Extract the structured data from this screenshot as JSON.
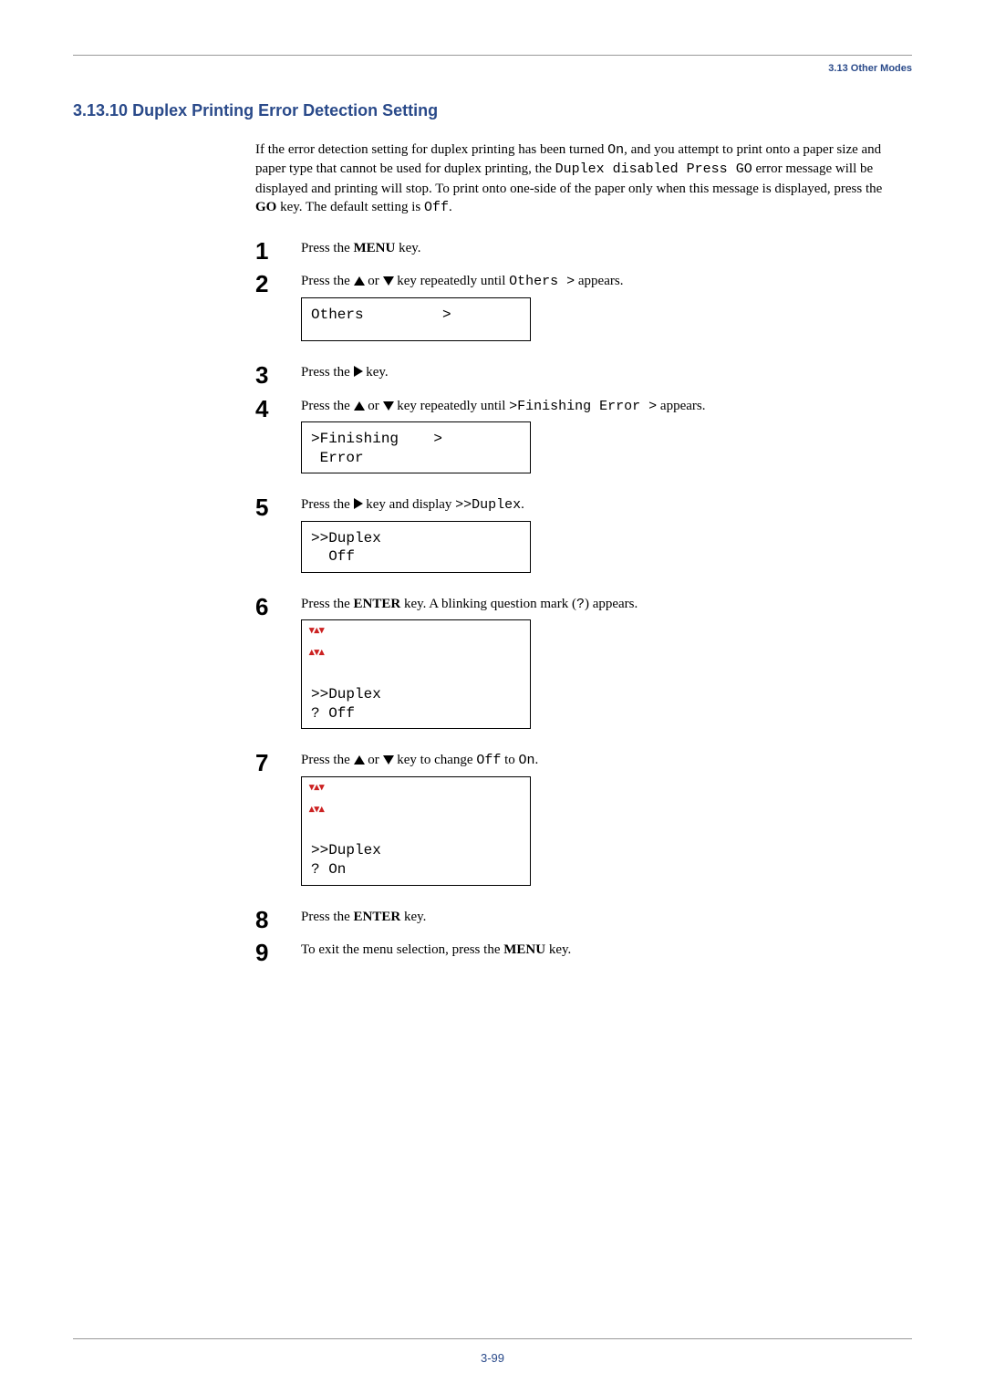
{
  "header": {
    "breadcrumb": "3.13 Other Modes"
  },
  "section": {
    "number": "3.13.10",
    "title": "Duplex Printing Error Detection Setting"
  },
  "intro": {
    "part1": "If the error detection setting for duplex printing has been turned ",
    "code1": "On",
    "part2": ", and you attempt to print onto a paper size and paper type that cannot be used for duplex printing, the ",
    "code2": "Duplex disabled Press GO",
    "part3": " error message will be displayed and printing will stop. To print onto one-side of the paper only when this message is displayed, press the ",
    "bold1": "GO",
    "part4": " key. The default setting is ",
    "code3": "Off",
    "part5": "."
  },
  "steps": {
    "s1": {
      "num": "1",
      "a": "Press the ",
      "b": "MENU",
      "c": " key."
    },
    "s2": {
      "num": "2",
      "a": "Press the ",
      "b_pre": " or ",
      "c": " key repeatedly until ",
      "code": "Others  >",
      "d": " appears.",
      "display_l1": "Others         >"
    },
    "s3": {
      "num": "3",
      "a": "Press the ",
      "c": " key."
    },
    "s4": {
      "num": "4",
      "a": "Press the ",
      "b_pre": " or ",
      "c": " key repeatedly until ",
      "code": ">Finishing Error  >",
      "d": " appears.",
      "display_l1": ">Finishing    >",
      "display_l2": " Error"
    },
    "s5": {
      "num": "5",
      "a": "Press the ",
      "c": " key and display ",
      "code": ">>Duplex",
      "d": ".",
      "display_l1": ">>Duplex",
      "display_l2": "  Off"
    },
    "s6": {
      "num": "6",
      "a": "Press the ",
      "b": "ENTER",
      "c": " key. A blinking question mark (",
      "code": "?",
      "d": ") appears.",
      "display_l1": ">>Duplex",
      "display_l2": "? Off"
    },
    "s7": {
      "num": "7",
      "a": "Press the ",
      "b_pre": " or ",
      "c": " key to change ",
      "code1": "Off",
      "mid": " to ",
      "code2": "On",
      "d": ".",
      "display_l1": ">>Duplex",
      "display_l2": "? On"
    },
    "s8": {
      "num": "8",
      "a": "Press the ",
      "b": "ENTER",
      "c": " key."
    },
    "s9": {
      "num": "9",
      "a": "To exit the menu selection, press the ",
      "b": "MENU",
      "c": " key."
    }
  },
  "footer": {
    "page": "3-99"
  }
}
